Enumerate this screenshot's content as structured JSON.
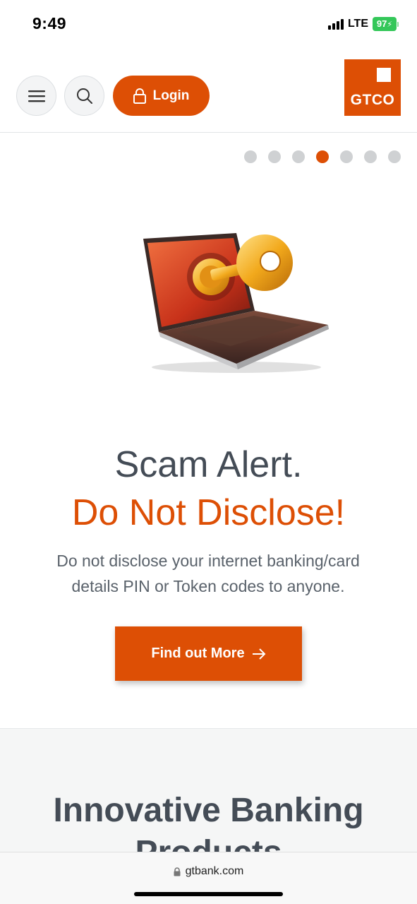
{
  "status_bar": {
    "time": "9:49",
    "network": "LTE",
    "battery": "97"
  },
  "header": {
    "login_label": "Login",
    "logo_text": "GTCO"
  },
  "carousel": {
    "total": 7,
    "active_index": 3
  },
  "hero": {
    "headline_line1": "Scam Alert.",
    "headline_line2": "Do Not Disclose!",
    "description": "Do not disclose your internet banking/card details PIN or Token codes to anyone.",
    "cta_label": "Find out More"
  },
  "section": {
    "title": "Innovative Banking Products"
  },
  "browser": {
    "url": "gtbank.com"
  },
  "colors": {
    "brand": "#dd4f05",
    "text": "#444c56"
  },
  "icons": [
    "signal-icon",
    "battery-icon",
    "menu-icon",
    "search-icon",
    "lock-icon",
    "arrow-right-icon"
  ]
}
